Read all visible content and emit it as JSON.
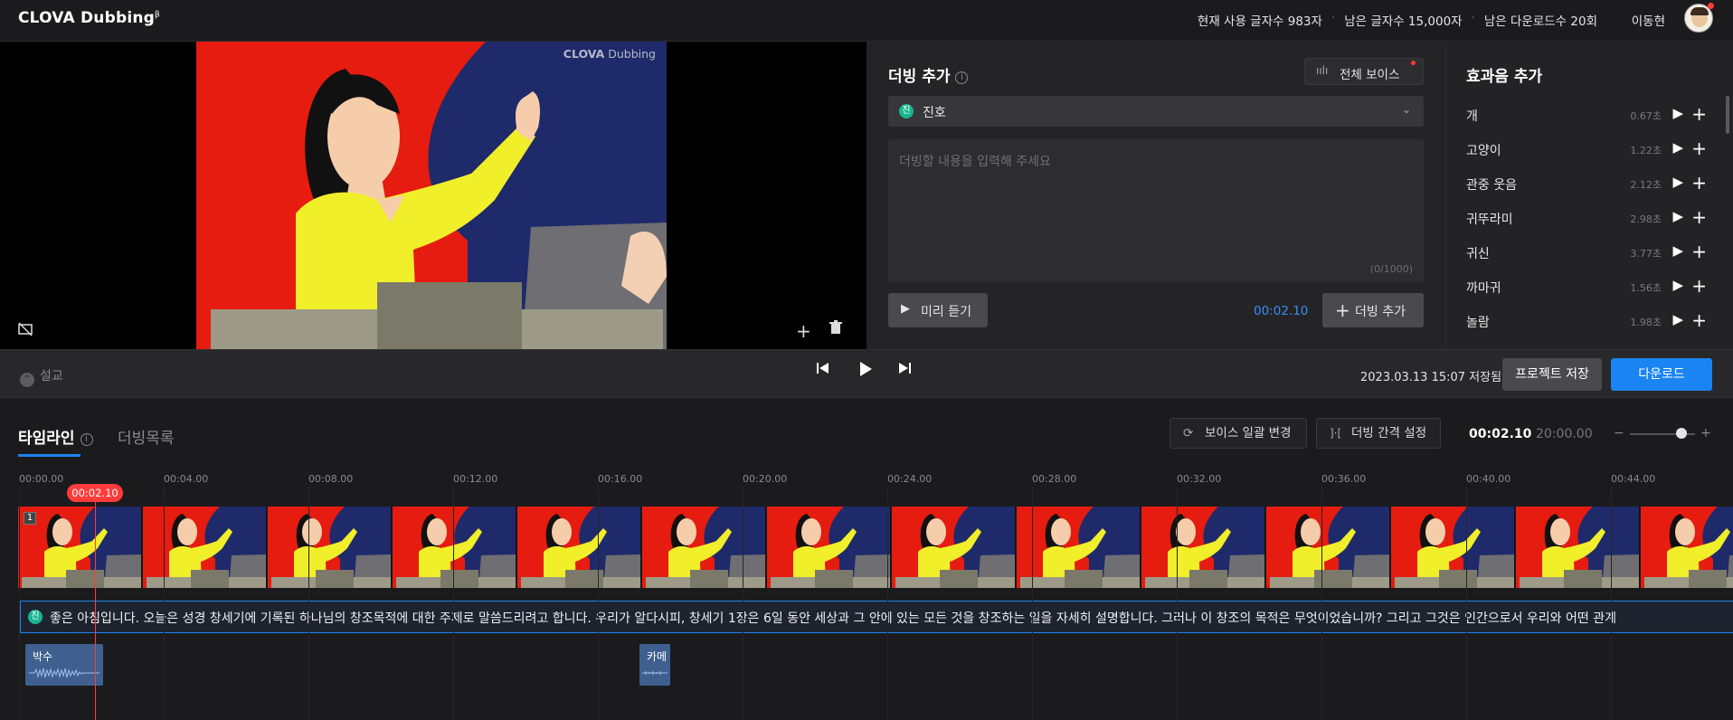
{
  "header": {
    "logo_main": "CLOVA Dubbing",
    "logo_mark": "β",
    "usage_chars": "현재 사용 글자수 983자",
    "remaining_chars": "남은 글자수 15,000자",
    "remaining_downloads": "남은 다운로드수 20회",
    "user_name": "이동현"
  },
  "preview": {
    "watermark_bold": "CLOVA",
    "watermark_rest": " Dubbing"
  },
  "dubbing": {
    "title": "더빙 추가",
    "all_voices_label": "전체 보이스",
    "voice_badge": "진",
    "voice_name": "진호",
    "text_placeholder": "더빙할 내용을 입력해 주세요",
    "char_count": "(0/1000)",
    "preview_label": "미리 듣기",
    "current_time": "00:02.10",
    "add_label": "더빙 추가"
  },
  "effects": {
    "title": "효과음 추가",
    "items": [
      {
        "name": "개",
        "duration": "0.67초"
      },
      {
        "name": "고양이",
        "duration": "1.22초"
      },
      {
        "name": "관중 웃음",
        "duration": "2.12초"
      },
      {
        "name": "귀뚜라미",
        "duration": "2.98초"
      },
      {
        "name": "귀신",
        "duration": "3.77초"
      },
      {
        "name": "까마귀",
        "duration": "1.56초"
      },
      {
        "name": "놀람",
        "duration": "1.98초"
      }
    ]
  },
  "controls": {
    "guide_label": "설교",
    "saved_text": "2023.03.13 15:07 저장됨",
    "save_project_label": "프로젝트 저장",
    "download_label": "다운로드"
  },
  "timeline": {
    "tab_timeline": "타임라인",
    "tab_dub_list": "더빙목록",
    "bulk_voice_label": "보이스 일괄 변경",
    "interval_label": "더빙 간격 설정",
    "current_time": "00:02.10",
    "total_time": "20:00.00",
    "zoom_level": 0.72,
    "ruler_labels": [
      "00:00.00",
      "00:04.00",
      "00:08.00",
      "00:12.00",
      "00:16.00",
      "00:20.00",
      "00:24.00",
      "00:28.00",
      "00:32.00",
      "00:36.00",
      "00:40.00",
      "00:44.00"
    ],
    "playhead_label": "00:02.10",
    "track_number": "1",
    "dub_badge": "진",
    "dub_text": "좋은 아침입니다. 오늘은 성경 창세기에 기록된 하나님의 창조목적에 대한 주제로 말씀드리려고 합니다. 우리가 알다시피, 창세기 1장은 6일 동안 세상과 그 안에 있는 모든 것을 창조하는 일을 자세히 설명합니다. 그러나 이 창조의 목적은 무엇이었습니까? 그리고 그것은 인간으로서 우리와 어떤 관계",
    "fx_clips": [
      {
        "label": "박수"
      },
      {
        "label": "카메"
      }
    ]
  },
  "colors": {
    "accent_blue": "#1b84f3",
    "playhead_red": "#ff3b3b",
    "voice_green": "#18b58f"
  }
}
